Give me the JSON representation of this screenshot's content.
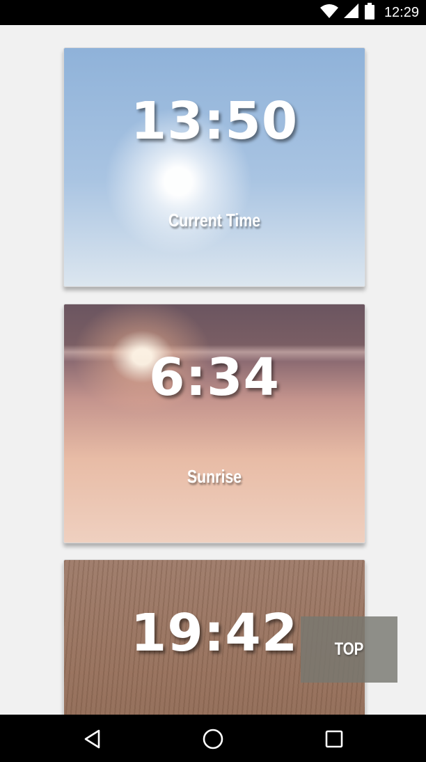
{
  "status_bar": {
    "time": "12:29",
    "icons": [
      "wifi-icon",
      "cellular-signal-icon",
      "battery-icon"
    ]
  },
  "cards": [
    {
      "time": "13:50",
      "label": "Current Time",
      "background": "sunny-sky-image"
    },
    {
      "time": "6:34",
      "label": "Sunrise",
      "background": "lake-sunrise-image"
    },
    {
      "time": "19:42",
      "label": "",
      "background": "field-grass-image"
    }
  ],
  "top_button": {
    "label": "TOP"
  },
  "nav_bar": {
    "icons": [
      "back-icon",
      "home-icon",
      "recents-icon"
    ]
  },
  "colors": {
    "background": "#f1f1f1",
    "bars": "#000000",
    "top_button": "#78786f"
  }
}
